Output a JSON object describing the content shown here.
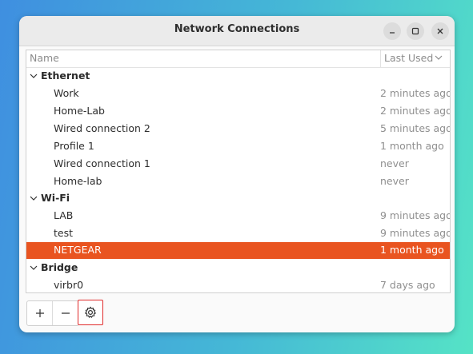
{
  "window": {
    "title": "Network Connections"
  },
  "columns": {
    "name": "Name",
    "last_used": "Last Used"
  },
  "groups": [
    {
      "name": "Ethernet",
      "items": [
        {
          "name": "Work",
          "last_used": "2 minutes ago"
        },
        {
          "name": "Home-Lab",
          "last_used": "2 minutes ago"
        },
        {
          "name": "Wired connection 2",
          "last_used": "5 minutes ago"
        },
        {
          "name": "Profile 1",
          "last_used": "1 month ago"
        },
        {
          "name": "Wired connection 1",
          "last_used": "never"
        },
        {
          "name": "Home-lab",
          "last_used": "never"
        }
      ]
    },
    {
      "name": "Wi-Fi",
      "items": [
        {
          "name": "LAB",
          "last_used": "9 minutes ago"
        },
        {
          "name": "test",
          "last_used": "9 minutes ago"
        },
        {
          "name": "NETGEAR",
          "last_used": "1 month ago",
          "selected": true
        }
      ]
    },
    {
      "name": "Bridge",
      "items": [
        {
          "name": "virbr0",
          "last_used": "7 days ago"
        }
      ]
    }
  ],
  "toolbar": {
    "add_label": "+",
    "remove_label": "−"
  },
  "colors": {
    "selection": "#e95420",
    "highlight_box": "#e02b2b"
  }
}
